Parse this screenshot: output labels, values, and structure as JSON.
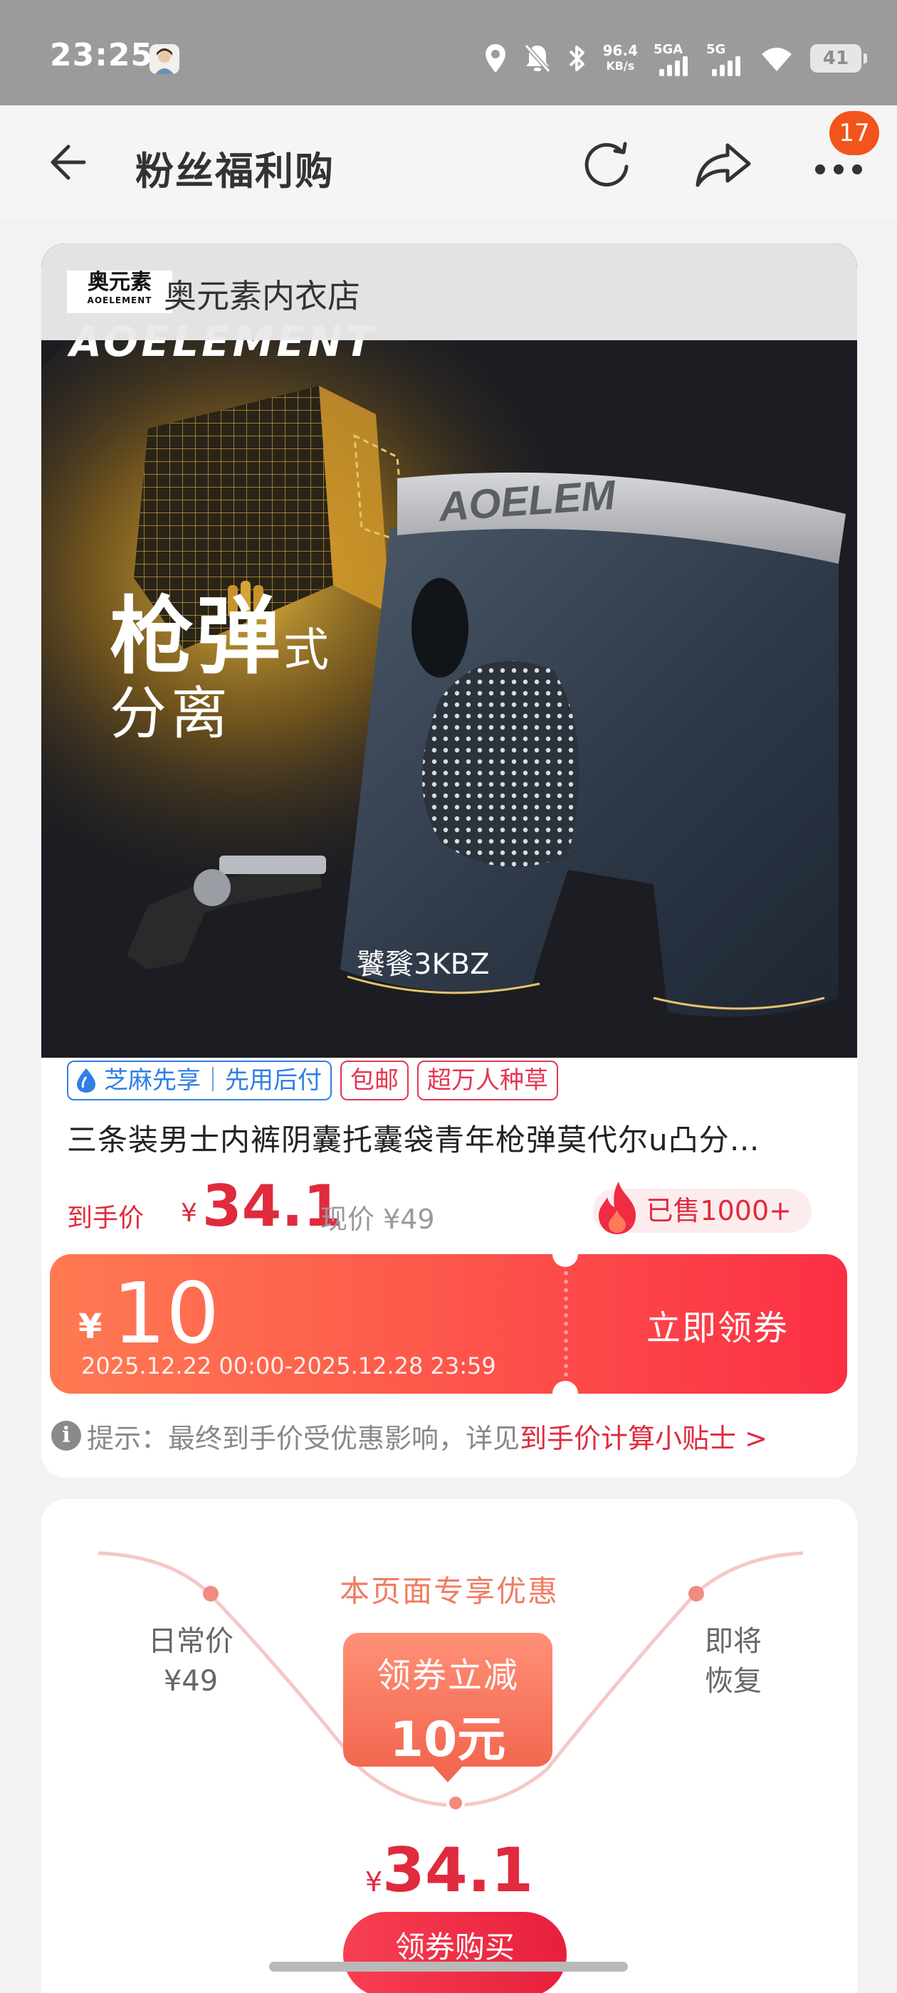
{
  "status_bar": {
    "time": "23:25",
    "net_speed_value": "96.4",
    "net_speed_unit": "KB/s",
    "sim1": "5GA",
    "sim2": "5G",
    "battery": "41",
    "icons": [
      "avatar-icon",
      "location-icon",
      "mute-bell-icon",
      "bluetooth-icon",
      "signal-icon",
      "wifi-icon",
      "battery-icon"
    ]
  },
  "header": {
    "title": "粉丝福利购",
    "badge_count": "17",
    "icons": [
      "back-arrow-icon",
      "refresh-icon",
      "share-icon",
      "more-icon"
    ]
  },
  "product": {
    "store_name": "奥元素内衣店",
    "store_logo_main": "奥元素",
    "store_logo_sub": "AOELEMENT",
    "hero": {
      "brand_text": "AOELEMENT",
      "headline_main": "枪弹",
      "headline_suffix": "式",
      "headline_second": "分离",
      "watermark": "饕餮3KBZ"
    },
    "tags": [
      "芝麻先享｜先用后付",
      "包邮",
      "超万人种草"
    ],
    "title": "三条装男士内裤阴囊托囊袋青年枪弹莫代尔u凸分…",
    "price_label": "到手价",
    "currency": "¥",
    "price": "34.1",
    "original_price_label": "现价 ¥49",
    "sold": "已售1000+",
    "coupon": {
      "currency": "¥",
      "amount": "10",
      "valid_dates": "2025.12.22 00:00-2025.12.28 23:59",
      "action": "立即领券"
    },
    "tip": {
      "prefix": "提示：最终到手价受优惠影响，详见",
      "link": "到手价计算小贴士 >"
    }
  },
  "promo": {
    "title": "本页面专享优惠",
    "left_label": "日常价",
    "left_price": "¥49",
    "right_line1": "即将",
    "right_line2": "恢复",
    "box_line1": "领券立减",
    "box_line2": "10元",
    "currency": "¥",
    "final_price": "34.1",
    "buy_button": "领券购买"
  },
  "colors": {
    "accent_red": "#e02a3d",
    "coupon_start": "#fe7a52",
    "coupon_end": "#fb2f45",
    "badge_orange": "#f2541c",
    "promo_coral": "#f07c63"
  }
}
